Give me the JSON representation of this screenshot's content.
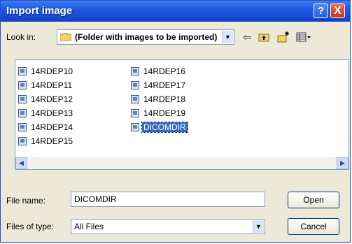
{
  "window": {
    "title": "Import image"
  },
  "titlebar_buttons": {
    "help": "?",
    "close": "X"
  },
  "lookin": {
    "label": "Look in:",
    "folder": "(Folder with images to be imported)"
  },
  "toolbar": [
    "back-icon",
    "up-folder-icon",
    "new-folder-icon",
    "views-menu-icon"
  ],
  "files": {
    "column1": [
      "14RDEP10",
      "14RDEP11",
      "14RDEP12",
      "14RDEP13",
      "14RDEP14",
      "14RDEP15"
    ],
    "column2": [
      "14RDEP16",
      "14RDEP17",
      "14RDEP18",
      "14RDEP19",
      "DICOMDIR"
    ],
    "selected": "DICOMDIR"
  },
  "filename": {
    "label": "File name:",
    "value": "DICOMDIR"
  },
  "filetype": {
    "label": "Files of type:",
    "value": "All Files"
  },
  "buttons": {
    "open": "Open",
    "cancel": "Cancel"
  },
  "colors": {
    "titlebar": "#1f5ae0",
    "selection": "#316ac5",
    "dialog_bg": "#ece9d8"
  }
}
